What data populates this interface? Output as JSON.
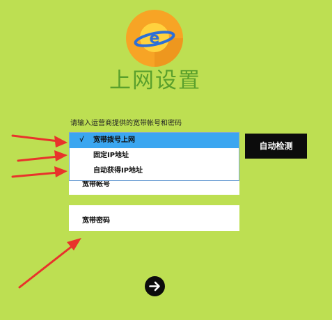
{
  "page": {
    "title": "上网设置",
    "hint": "请输入运营商提供的宽带帐号和密码"
  },
  "dropdown": {
    "options": [
      {
        "label": "宽带拨号上网",
        "selected": true,
        "check": "√"
      },
      {
        "label": "固定IP地址",
        "selected": false
      },
      {
        "label": "自动获得IP地址",
        "selected": false
      }
    ]
  },
  "fields": {
    "account_label": "宽带帐号",
    "password_label": "宽带密码"
  },
  "buttons": {
    "detect_label": "自动检测"
  },
  "colors": {
    "background": "#bddf52",
    "title": "#5aa02c",
    "selected_option": "#3ba6f0",
    "button": "#0c0c0c",
    "annotation_arrow": "#e8332b"
  },
  "icons": {
    "logo": "browser-e-planet-icon",
    "next": "arrow-right-circle-icon"
  }
}
